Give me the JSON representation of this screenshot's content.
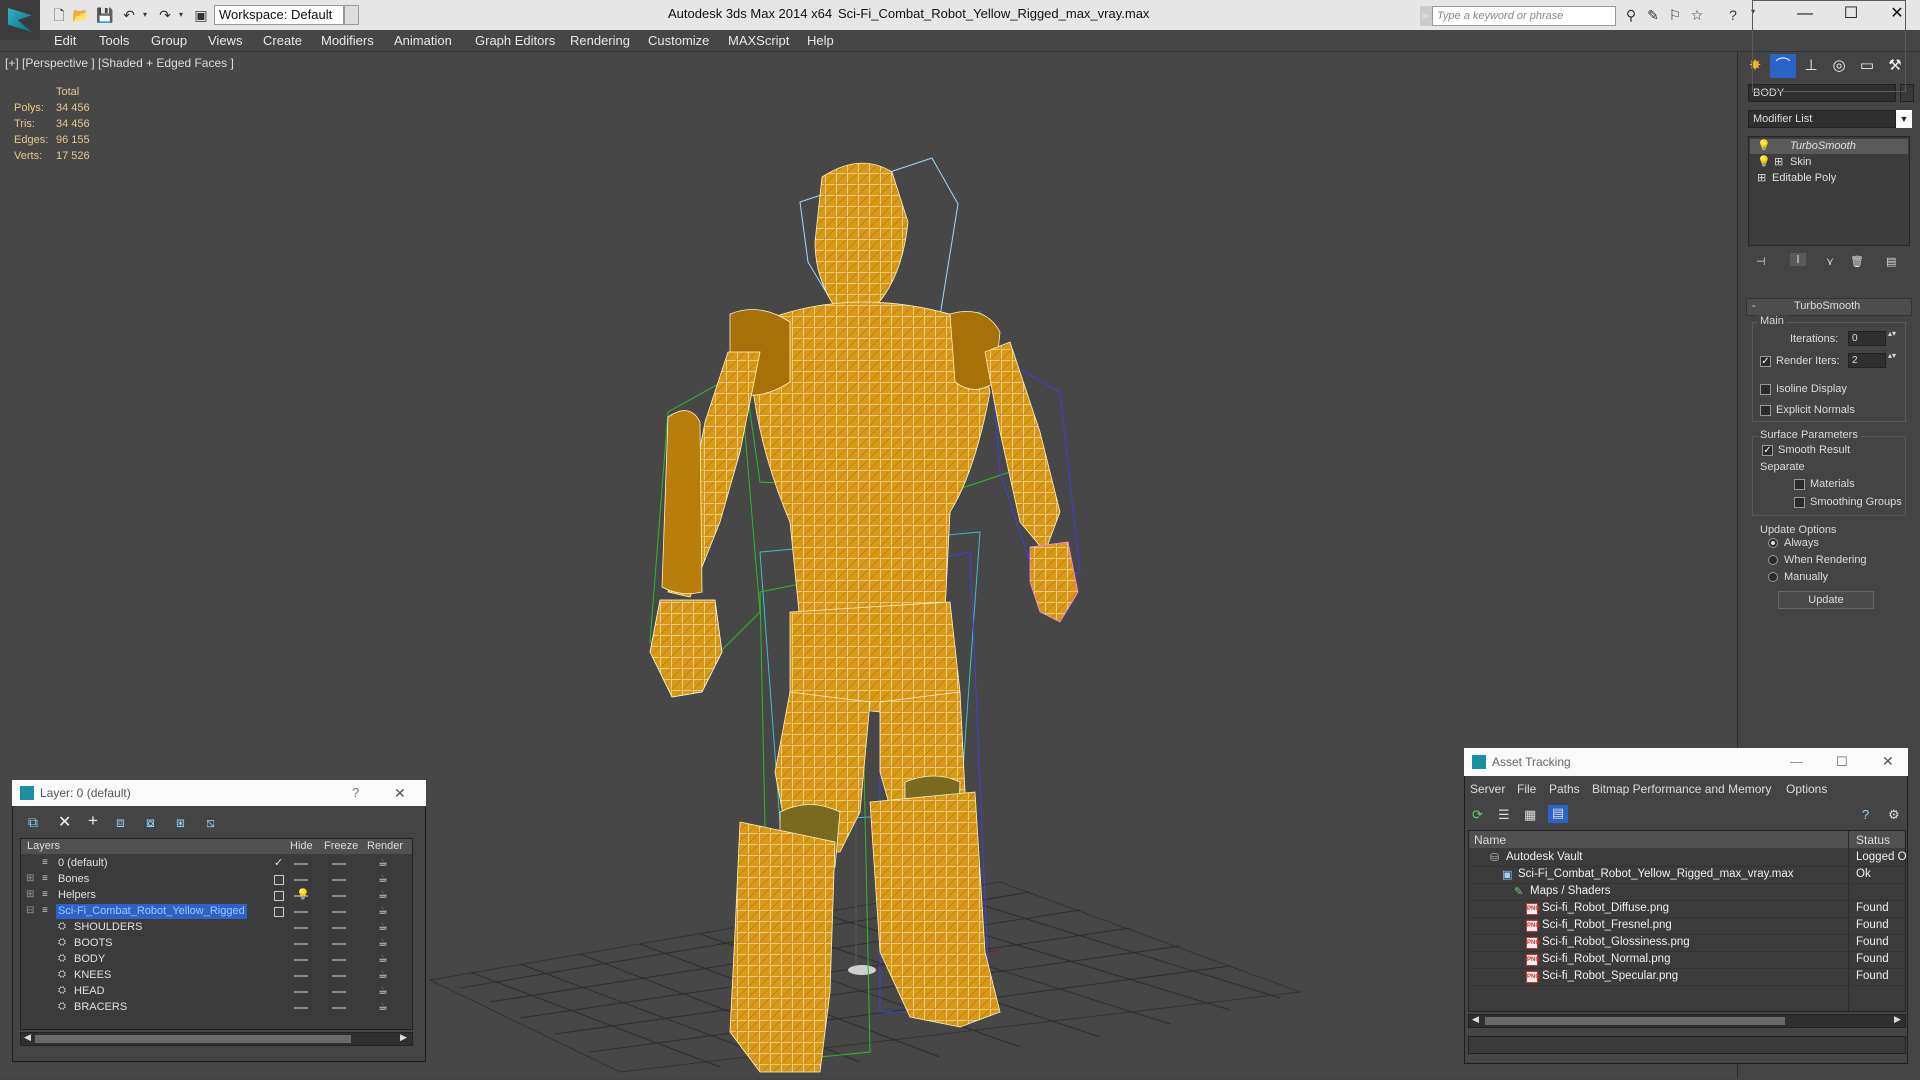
{
  "titlebar": {
    "workspace": "Workspace: Default",
    "app": "Autodesk 3ds Max  2014 x64",
    "file": "Sci-Fi_Combat_Robot_Yellow_Rigged_max_vray.max",
    "search_placeholder": "Type a keyword or phrase"
  },
  "menu": [
    "Edit",
    "Tools",
    "Group",
    "Views",
    "Create",
    "Modifiers",
    "Animation",
    "Graph Editors",
    "Rendering",
    "Customize",
    "MAXScript",
    "Help"
  ],
  "viewport": {
    "label": "[+] [Perspective ] [Shaded + Edged Faces ]",
    "stats": {
      "header": "Total",
      "rows": [
        {
          "label": "Polys:",
          "value": "34 456"
        },
        {
          "label": "Tris:",
          "value": "34 456"
        },
        {
          "label": "Edges:",
          "value": "96 155"
        },
        {
          "label": "Verts:",
          "value": "17 526"
        }
      ]
    }
  },
  "command_panel": {
    "object_name": "BODY",
    "modifier_list": "Modifier List",
    "stack": [
      "TurboSmooth",
      "Skin",
      "Editable Poly"
    ],
    "rollout_title": "TurboSmooth",
    "main": {
      "title": "Main",
      "iterations_label": "Iterations:",
      "iterations_value": "0",
      "render_iters_label": "Render Iters:",
      "render_iters_value": "2",
      "isoline": "Isoline Display",
      "explicit": "Explicit Normals"
    },
    "surface": {
      "title": "Surface Parameters",
      "smooth": "Smooth Result",
      "separate": "Separate",
      "materials": "Materials",
      "smoothing_groups": "Smoothing Groups"
    },
    "update": {
      "title": "Update Options",
      "always": "Always",
      "when_rendering": "When Rendering",
      "manually": "Manually",
      "button": "Update"
    }
  },
  "layer_dialog": {
    "title": "Layer: 0 (default)",
    "help": "?",
    "close": "✕",
    "columns": [
      "Layers",
      "Hide",
      "Freeze",
      "Render"
    ],
    "rows": [
      {
        "name": "0 (default)",
        "indent": 0,
        "expand": "",
        "active": true
      },
      {
        "name": "Bones",
        "indent": 0,
        "expand": "+",
        "active": false
      },
      {
        "name": "Helpers",
        "indent": 0,
        "expand": "+",
        "active": false
      },
      {
        "name": "Sci-Fi_Combat_Robot_Yellow_Rigged",
        "indent": 0,
        "expand": "−",
        "active": false,
        "selected": true
      },
      {
        "name": "SHOULDERS",
        "indent": 1
      },
      {
        "name": "BOOTS",
        "indent": 1
      },
      {
        "name": "BODY",
        "indent": 1
      },
      {
        "name": "KNEES",
        "indent": 1
      },
      {
        "name": "HEAD",
        "indent": 1
      },
      {
        "name": "BRACERS",
        "indent": 1
      }
    ]
  },
  "asset_dialog": {
    "title": "Asset Tracking",
    "menu": [
      "Server",
      "File",
      "Paths",
      "Bitmap Performance and Memory",
      "Options"
    ],
    "columns": [
      "Name",
      "Status"
    ],
    "rows": [
      {
        "name": "Autodesk Vault",
        "status": "Logged O",
        "indent": 1,
        "icon": "vault"
      },
      {
        "name": "Sci-Fi_Combat_Robot_Yellow_Rigged_max_vray.max",
        "status": "Ok",
        "indent": 2,
        "icon": "max"
      },
      {
        "name": "Maps / Shaders",
        "status": "",
        "indent": 3,
        "icon": "maps"
      },
      {
        "name": "Sci-fi_Robot_Diffuse.png",
        "status": "Found",
        "indent": 4,
        "icon": "png"
      },
      {
        "name": "Sci-fi_Robot_Fresnel.png",
        "status": "Found",
        "indent": 4,
        "icon": "png"
      },
      {
        "name": "Sci-fi_Robot_Glossiness.png",
        "status": "Found",
        "indent": 4,
        "icon": "png"
      },
      {
        "name": "Sci-fi_Robot_Normal.png",
        "status": "Found",
        "indent": 4,
        "icon": "png"
      },
      {
        "name": "Sci-fi_Robot_Specular.png",
        "status": "Found",
        "indent": 4,
        "icon": "png"
      }
    ]
  },
  "colors": {
    "viewport_bg": "#474747",
    "accent_selection": "#2a64c8",
    "stats_text": "#e6c98a",
    "robot_yellow": "#d89a16"
  }
}
